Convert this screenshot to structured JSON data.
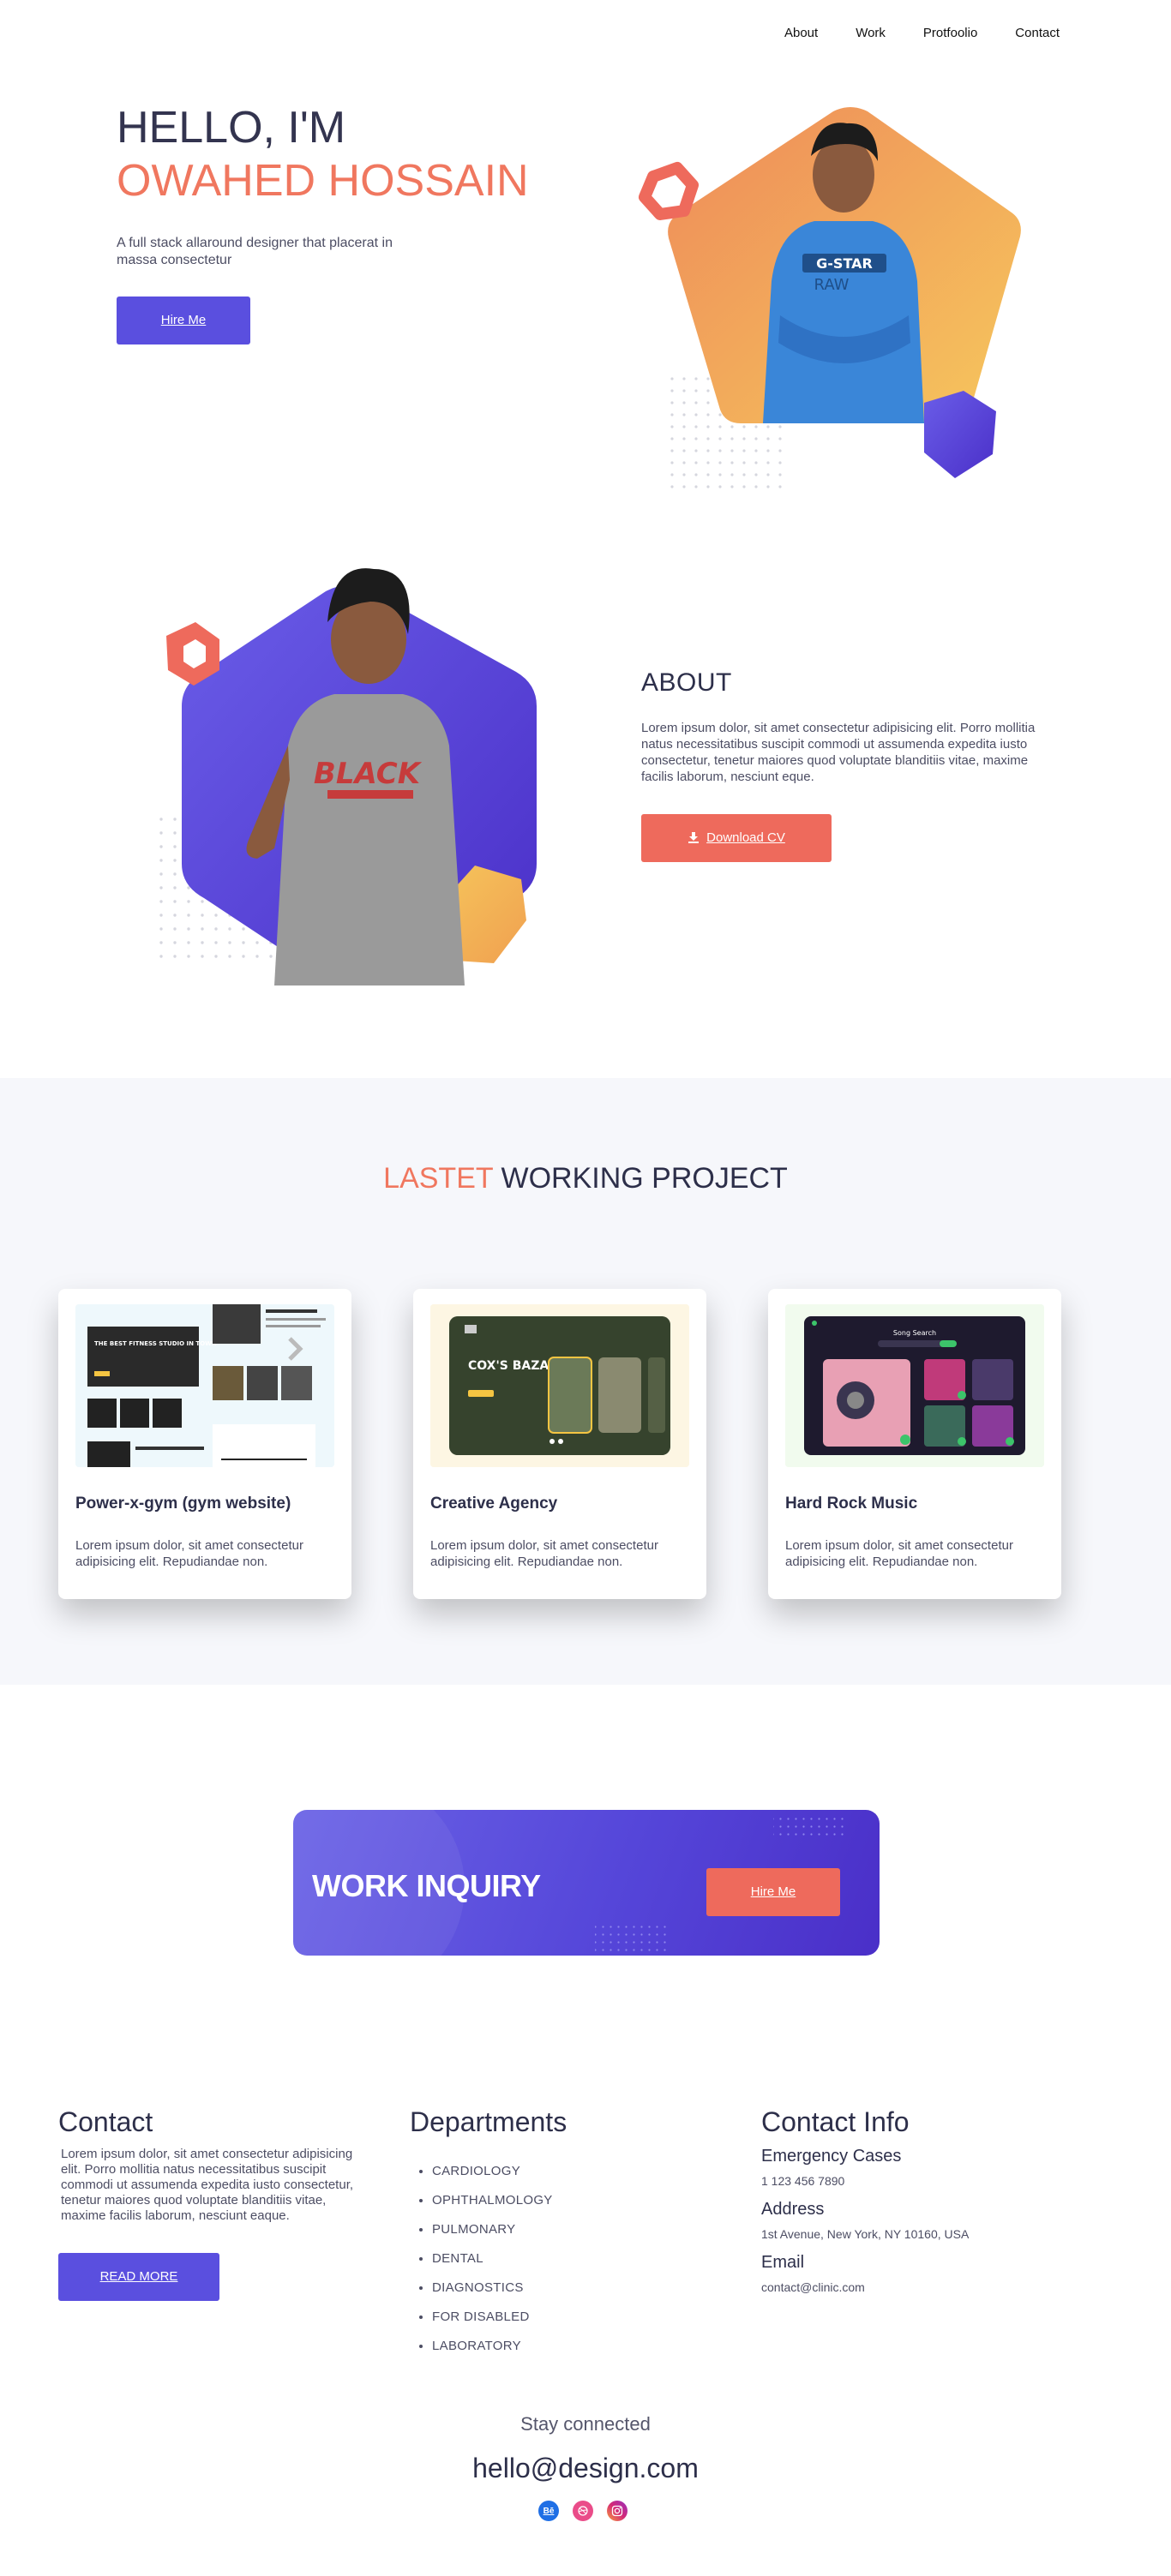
{
  "nav": {
    "items": [
      "About",
      "Work",
      "Protfoolio",
      "Contact"
    ]
  },
  "hero": {
    "greeting": "HELLO, I'M",
    "name": "OWAHED HOSSAIN",
    "description": "A full stack allaround designer that placerat in massa consectetur",
    "button": "Hire Me"
  },
  "about": {
    "title": "ABOUT",
    "description": "Lorem ipsum dolor, sit amet consectetur adipisicing elit. Porro mollitia natus necessitatibus suscipit commodi ut assumenda expedita iusto consectetur, tenetur maiores quod voluptate blanditiis vitae, maxime facilis laborum, nesciunt eque.",
    "button": "Download CV",
    "shirt_text": "BLACK"
  },
  "projects": {
    "title_accent": "LASTET",
    "title_rest": "WORKING PROJECT",
    "cards": [
      {
        "title": "Power-x-gym (gym website)",
        "description": "Lorem ipsum dolor, sit amet consectetur adipisicing elit. Repudiandae non.",
        "thumb_text": "THE BEST FITNESS STUDIO IN TOWN"
      },
      {
        "title": "Creative Agency",
        "description": "Lorem ipsum dolor, sit amet consectetur adipisicing elit. Repudiandae non.",
        "thumb_text": "COX'S BAZAR"
      },
      {
        "title": "Hard Rock Music",
        "description": "Lorem ipsum dolor, sit amet consectetur adipisicing elit. Repudiandae non.",
        "thumb_text": "Song Search"
      }
    ]
  },
  "inquiry": {
    "title": "WORK INQUIRY",
    "button": "Hire Me"
  },
  "footer": {
    "contact": {
      "title": "Contact",
      "text": "Lorem ipsum dolor, sit amet consectetur adipisicing elit. Porro mollitia natus necessitatibus suscipit commodi ut assumenda expedita iusto consectetur, tenetur maiores quod voluptate blanditiis vitae, maxime facilis laborum, nesciunt eaque.",
      "button": "READ MORE"
    },
    "departments": {
      "title": "Departments",
      "items": [
        "CARDIOLOGY",
        "OPHTHALMOLOGY",
        "PULMONARY",
        "DENTAL",
        "DIAGNOSTICS",
        "FOR DISABLED",
        "LABORATORY"
      ]
    },
    "contact_info": {
      "title": "Contact Info",
      "emergency_label": "Emergency Cases",
      "emergency_value": "1 123 456 7890",
      "address_label": "Address",
      "address_value": "1st Avenue, New York, NY 10160, USA",
      "email_label": "Email",
      "email_value": "contact@clinic.com"
    },
    "stay_connected": "Stay connected",
    "email": "hello@design.com",
    "socials": [
      "behance-icon",
      "dribbble-icon",
      "instagram-icon"
    ],
    "behance_glyph": "Bē"
  },
  "colors": {
    "primary": "#5a4fdf",
    "accent": "#f0775f",
    "coral": "#ee6a5c",
    "text": "#2d2f4a"
  }
}
